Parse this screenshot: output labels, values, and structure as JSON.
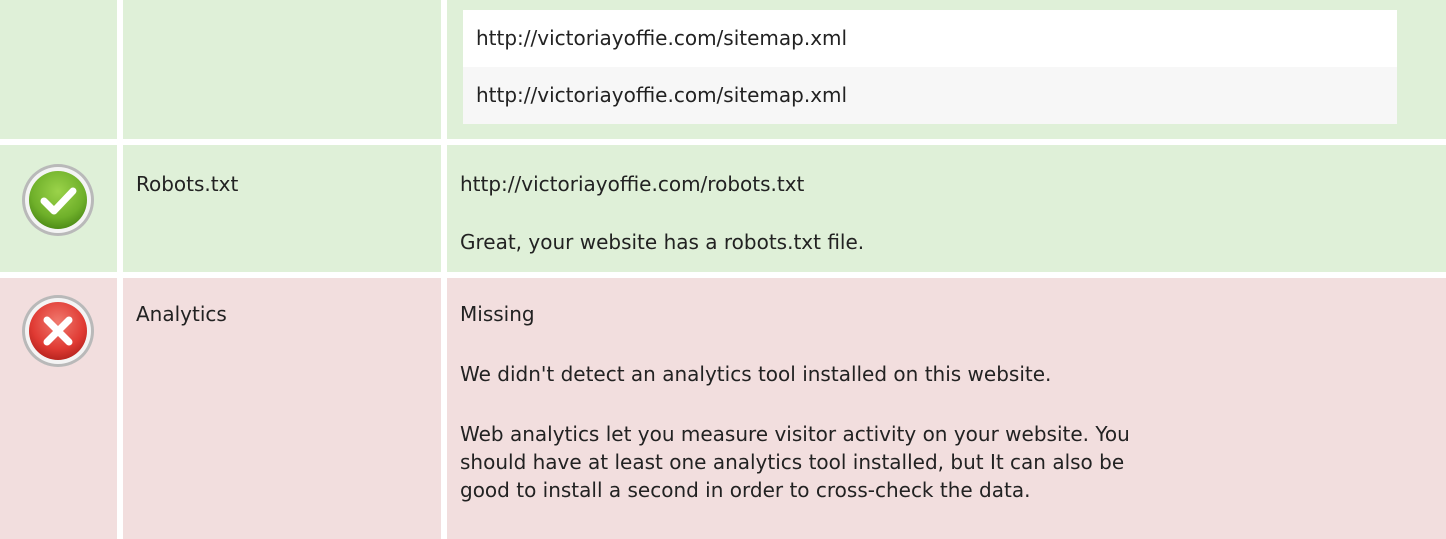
{
  "colors": {
    "pass_background": "#dff0d8",
    "fail_background": "#f2dede",
    "pass_icon": "#6fb02a",
    "fail_icon": "#e03a33"
  },
  "sitemap": {
    "items": [
      "http://victoriayoffie.com/sitemap.xml",
      "http://victoriayoffie.com/sitemap.xml"
    ]
  },
  "robots": {
    "status_icon": "check-icon",
    "label": "Robots.txt",
    "url": "http://victoriayoffie.com/robots.txt",
    "message": "Great, your website has a robots.txt file."
  },
  "analytics": {
    "status_icon": "cross-icon",
    "label": "Analytics",
    "status": "Missing",
    "message": "We didn't detect an analytics tool installed on this website.",
    "description_lines": [
      "Web analytics let you measure visitor activity on your website. You",
      "should have at least one analytics tool installed, but It can also be",
      "good to install a second in order to cross-check the data."
    ]
  }
}
